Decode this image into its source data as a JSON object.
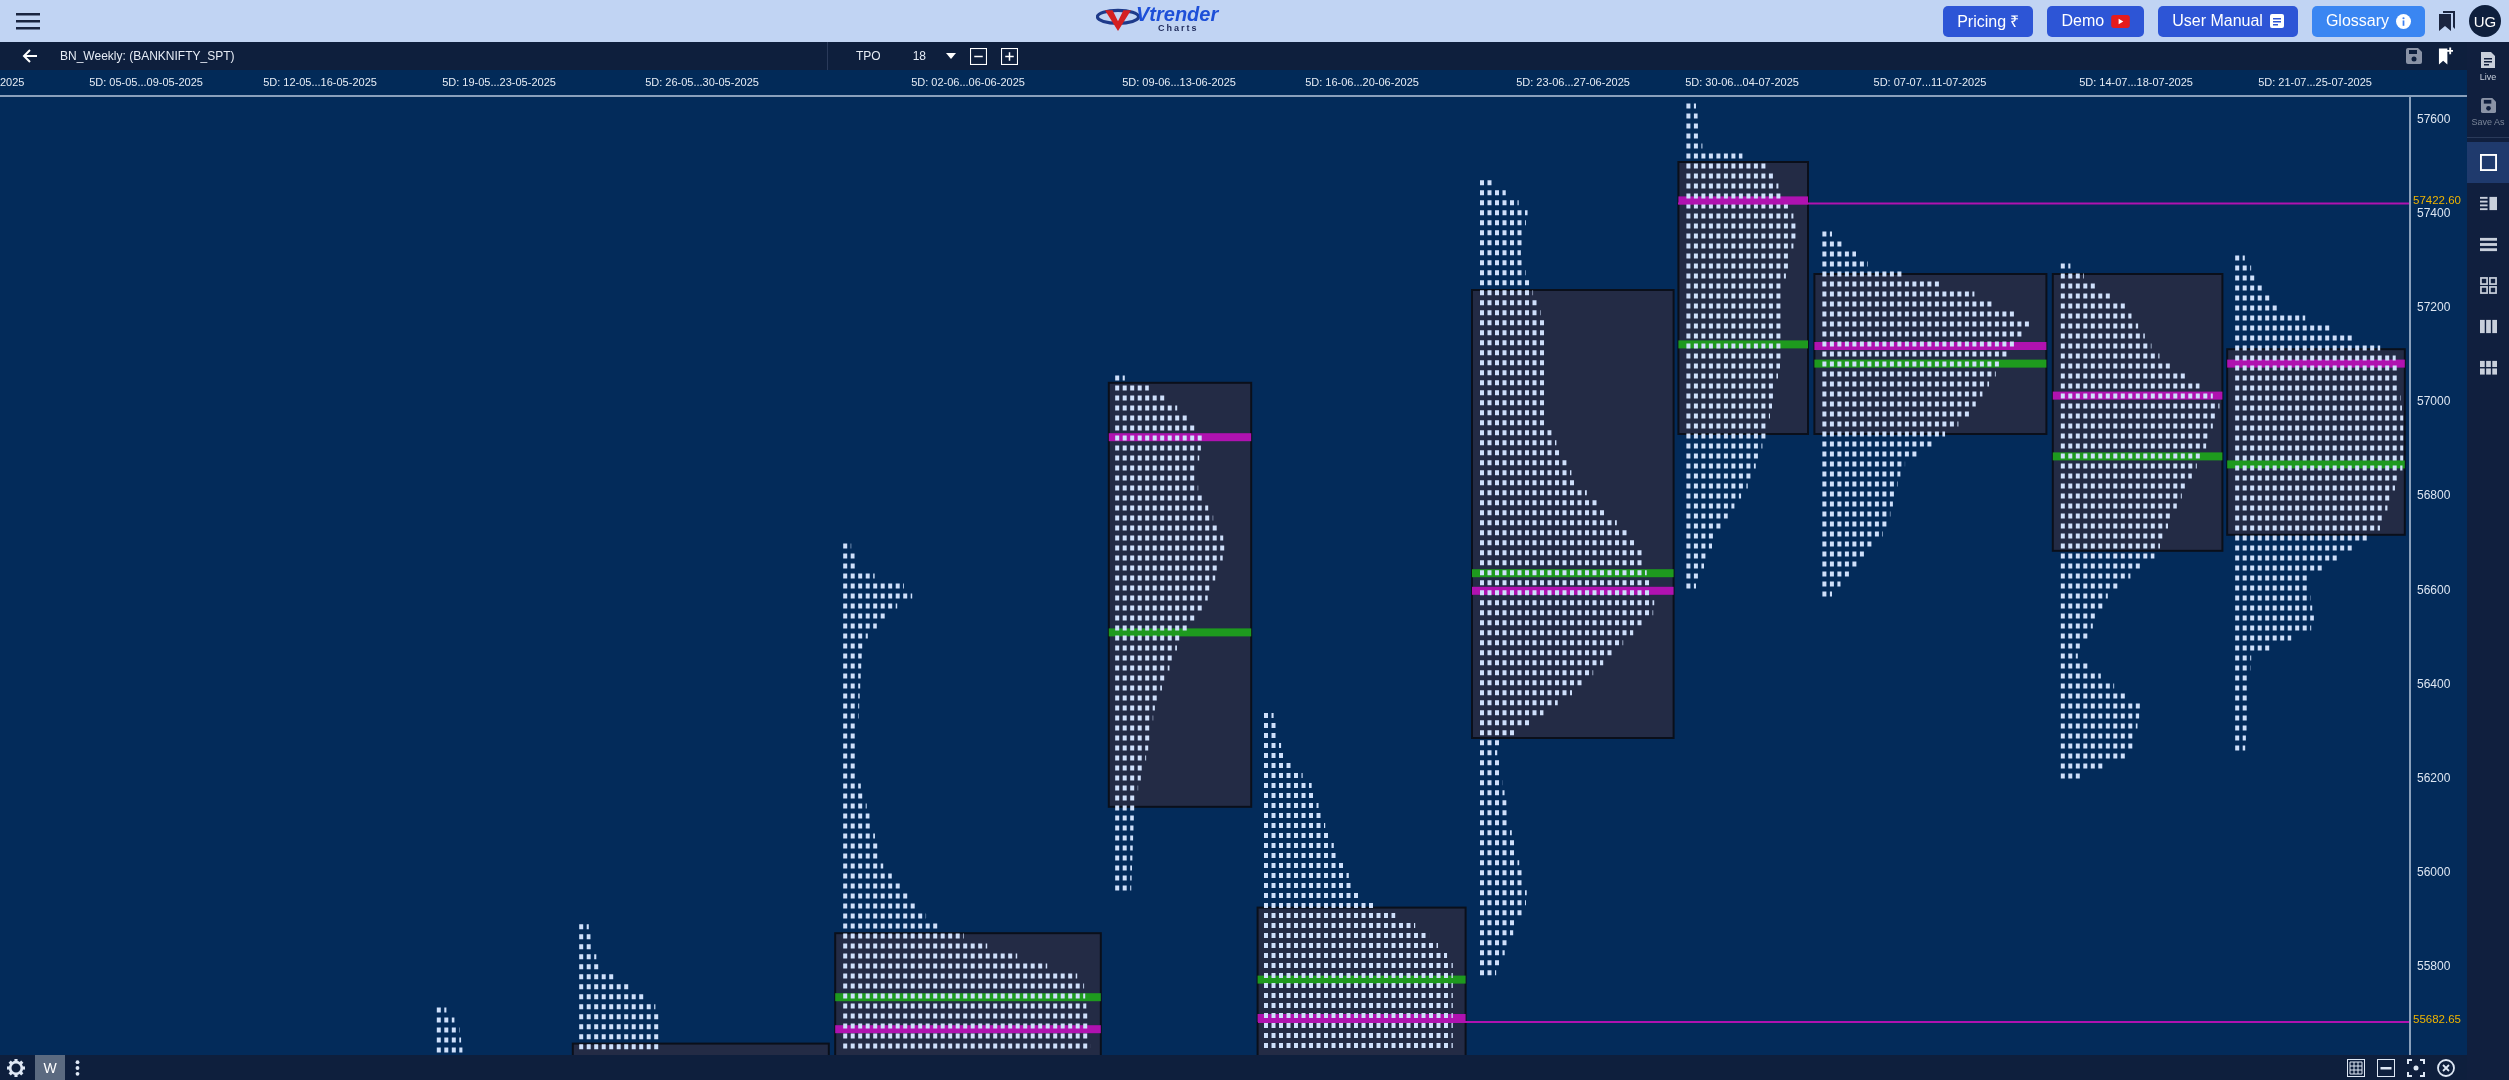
{
  "header": {
    "logo": {
      "brand": "Vtrender",
      "sub": "Charts"
    },
    "buttons": [
      {
        "label": "Pricing ₹",
        "kind": "pricing",
        "highlighted": false
      },
      {
        "label": "Demo",
        "kind": "video",
        "highlighted": false
      },
      {
        "label": "User Manual",
        "kind": "manual",
        "highlighted": false
      },
      {
        "label": "Glossary",
        "kind": "info",
        "highlighted": true
      }
    ],
    "avatar": "UG"
  },
  "toolbar": {
    "title": "BN_Weekly: (BANKNIFTY_SPT)",
    "mode": "TPO",
    "size": "18"
  },
  "date_labels": [
    "2025",
    "5D: 05-05...09-05-2025",
    "5D: 12-05...16-05-2025",
    "5D: 19-05...23-05-2025",
    "5D: 26-05...30-05-2025",
    "5D: 02-06...06-06-2025",
    "5D: 09-06...13-06-2025",
    "5D: 16-06...20-06-2025",
    "5D: 23-06...27-06-2025",
    "5D: 30-06...04-07-2025",
    "5D: 07-07...11-07-2025",
    "5D: 14-07...18-07-2025",
    "5D: 21-07...25-07-2025"
  ],
  "price_axis": {
    "ticks": [
      "57600",
      "57400",
      "57200",
      "57000",
      "56800",
      "56600",
      "56400",
      "56200",
      "56000",
      "55800"
    ],
    "markers": [
      "57422.60",
      "55682.65"
    ]
  },
  "sidebar": {
    "items": [
      {
        "label": "Live",
        "kind": "doc",
        "disabled": false
      },
      {
        "label": "Save As",
        "kind": "save",
        "disabled": true
      }
    ],
    "layouts": [
      {
        "kind": "single",
        "selected": true
      },
      {
        "kind": "list",
        "selected": false
      },
      {
        "kind": "rows",
        "selected": false
      },
      {
        "kind": "grid",
        "selected": false
      },
      {
        "kind": "columns",
        "selected": false
      },
      {
        "kind": "grid6",
        "selected": false
      }
    ]
  },
  "bottom_bar": {
    "interval": "W"
  }
}
